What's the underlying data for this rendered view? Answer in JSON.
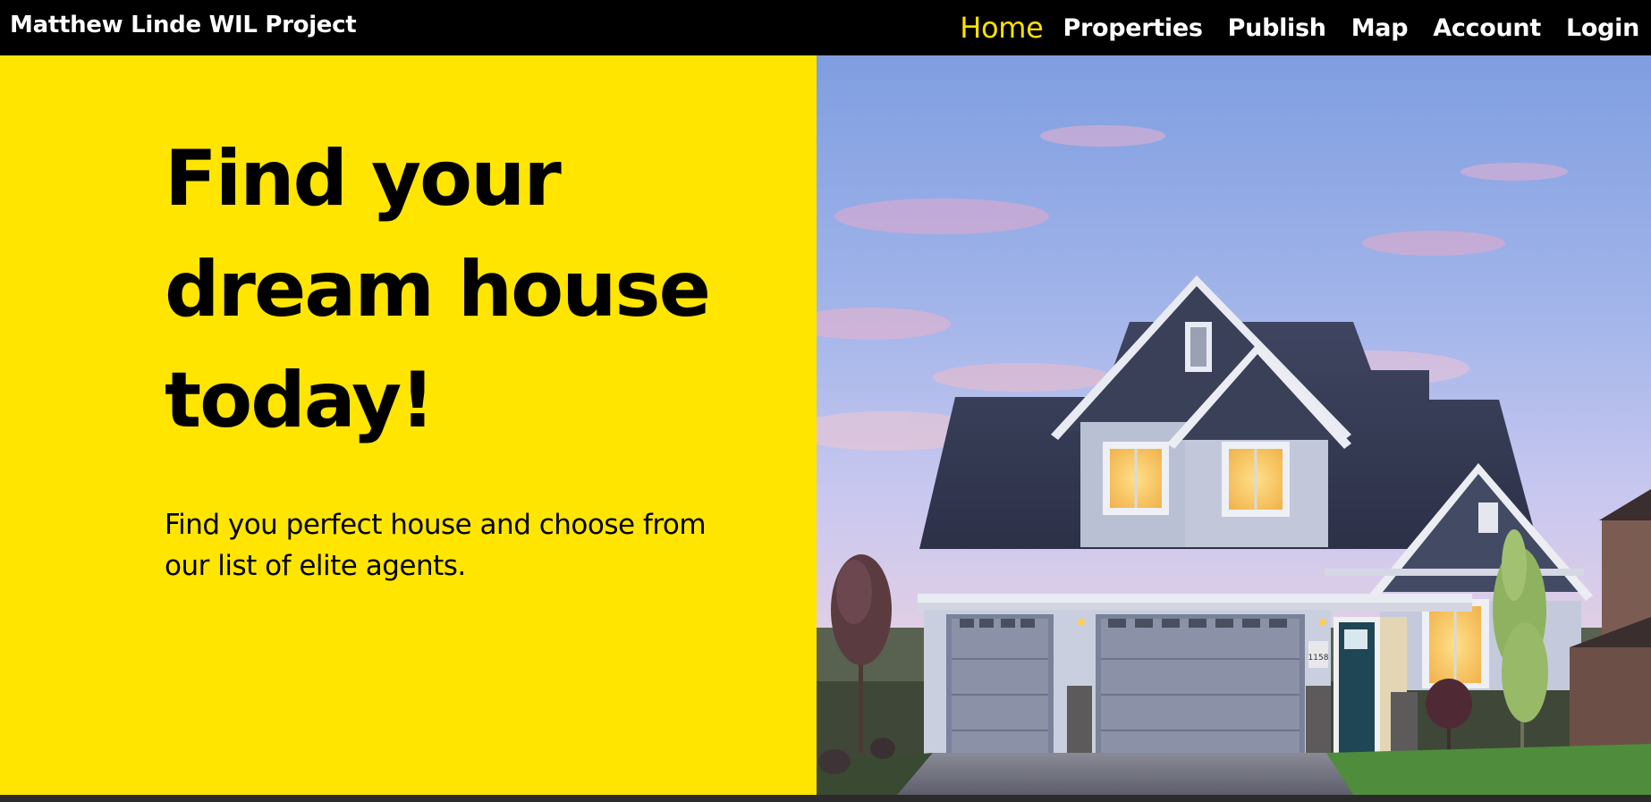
{
  "navbar": {
    "brand": "Matthew Linde WIL Project",
    "links": [
      {
        "label": "Home",
        "active": true
      },
      {
        "label": "Properties",
        "active": false
      },
      {
        "label": "Publish",
        "active": false
      },
      {
        "label": "Map",
        "active": false
      },
      {
        "label": "Account",
        "active": false
      },
      {
        "label": "Login",
        "active": false
      }
    ]
  },
  "hero": {
    "title": "Find your dream house today!",
    "subtitle": "Find you perfect house and choose from our list of elite agents.",
    "image_alt": "house-photo",
    "house_number": "1158"
  },
  "colors": {
    "nav_bg": "#000000",
    "accent": "#ffe500",
    "active_link": "#ffe100",
    "text": "#000000"
  }
}
